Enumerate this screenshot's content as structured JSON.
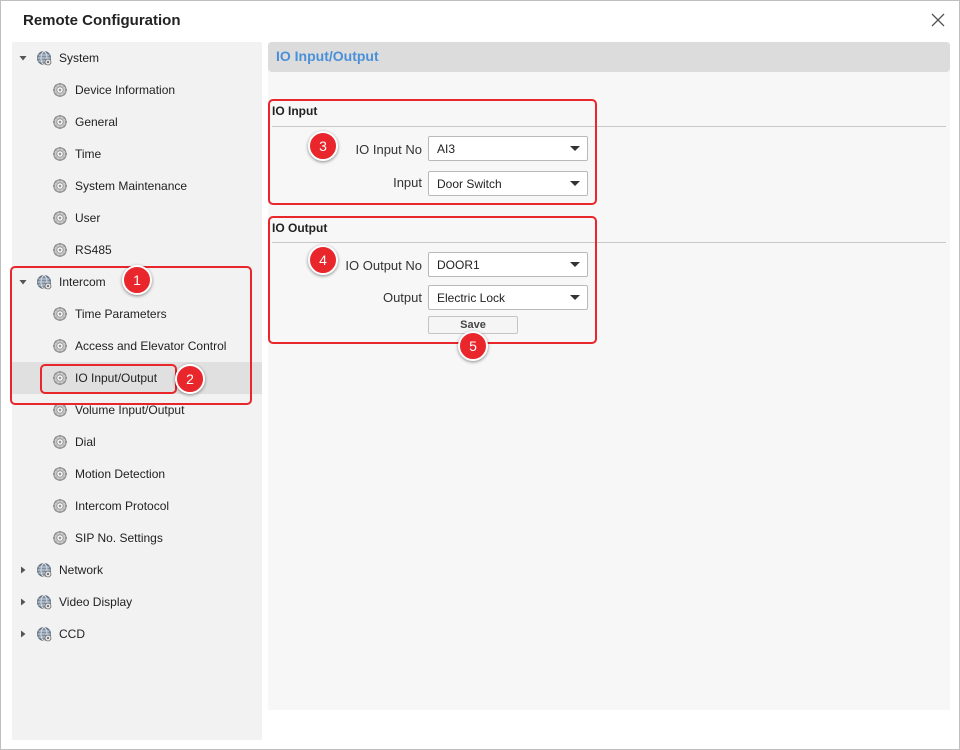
{
  "window": {
    "title": "Remote Configuration"
  },
  "tree": [
    {
      "label": "System",
      "level": 0,
      "arrow": "expanded"
    },
    {
      "label": "Device Information",
      "level": 1
    },
    {
      "label": "General",
      "level": 1
    },
    {
      "label": "Time",
      "level": 1
    },
    {
      "label": "System Maintenance",
      "level": 1
    },
    {
      "label": "User",
      "level": 1
    },
    {
      "label": "RS485",
      "level": 1
    },
    {
      "label": "Intercom",
      "level": 0,
      "arrow": "expanded"
    },
    {
      "label": "Time Parameters",
      "level": 1
    },
    {
      "label": "Access and Elevator Control",
      "level": 1
    },
    {
      "label": "IO Input/Output",
      "level": 1,
      "selected": true
    },
    {
      "label": "Volume Input/Output",
      "level": 1
    },
    {
      "label": "Dial",
      "level": 1
    },
    {
      "label": "Motion Detection",
      "level": 1
    },
    {
      "label": "Intercom Protocol",
      "level": 1
    },
    {
      "label": "SIP No. Settings",
      "level": 1
    },
    {
      "label": "Network",
      "level": 0,
      "arrow": "collapsed"
    },
    {
      "label": "Video Display",
      "level": 0,
      "arrow": "collapsed"
    },
    {
      "label": "CCD",
      "level": 0,
      "arrow": "collapsed"
    }
  ],
  "main": {
    "header": "IO Input/Output",
    "io_input": {
      "title": "IO Input",
      "input_no_label": "IO Input No",
      "input_no_value": "AI3",
      "input_label": "Input",
      "input_value": "Door Switch"
    },
    "io_output": {
      "title": "IO Output",
      "output_no_label": "IO Output No",
      "output_no_value": "DOOR1",
      "output_label": "Output",
      "output_value": "Electric Lock"
    },
    "save_label": "Save"
  },
  "annotations": {
    "badges": [
      "1",
      "2",
      "3",
      "4",
      "5"
    ],
    "color": "#e8262b"
  },
  "colors": {
    "header_text": "#4a90d9",
    "sidebar_bg": "#f2f2f2",
    "selected_bg": "#e0e0e0"
  }
}
